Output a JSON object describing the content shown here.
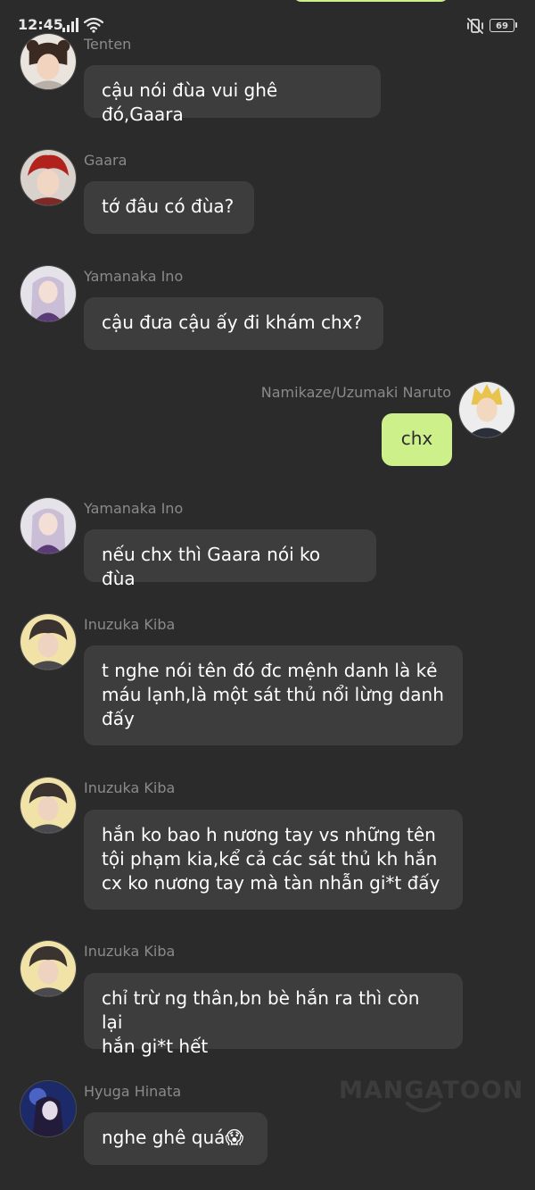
{
  "status_bar": {
    "time": "12:45",
    "battery": "69"
  },
  "watermark": "MANGATOON",
  "messages": [
    {
      "sender": "Tenten",
      "text": "cậu nói đùa vui ghê đó,Gaara"
    },
    {
      "sender": "Gaara",
      "text": "tớ đâu có đùa?"
    },
    {
      "sender": "Yamanaka Ino",
      "text": "cậu đưa cậu ấy đi khám chx?"
    },
    {
      "sender": "Namikaze/Uzumaki Naruto",
      "text": "chx",
      "own": true
    },
    {
      "sender": "Yamanaka Ino",
      "text": "nếu chx thì Gaara nói ko đùa"
    },
    {
      "sender": "Inuzuka Kiba",
      "text": "t nghe nói tên đó đc mệnh danh là kẻ\nmáu lạnh,là một sát thủ nổi lừng danh\nđấy"
    },
    {
      "sender": "Inuzuka Kiba",
      "text": "hắn ko bao h nương tay vs những tên\ntội phạm kia,kể cả các sát thủ kh hắn\ncx ko nương tay mà tàn nhẫn gi*t đấy"
    },
    {
      "sender": "Inuzuka Kiba",
      "text": "chỉ trừ ng thân,bn bè hắn ra thì còn lại\nhắn gi*t hết"
    },
    {
      "sender": "Hyuga Hinata",
      "text": "nghe ghê quá😱"
    }
  ]
}
